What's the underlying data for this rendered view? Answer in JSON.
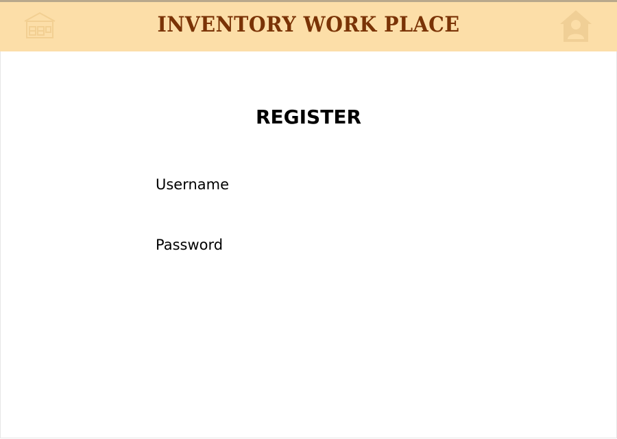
{
  "header": {
    "title": "INVENTORY WORK PLACE",
    "logo_icon": "warehouse-icon",
    "home_icon": "home-user-icon",
    "background_color": "#fcdea8",
    "title_color": "#7a3306"
  },
  "main": {
    "title": "REGISTER",
    "username": {
      "label": "Username",
      "value": "",
      "placeholder": ""
    },
    "password": {
      "label": "Password",
      "value": "",
      "placeholder": ""
    }
  }
}
